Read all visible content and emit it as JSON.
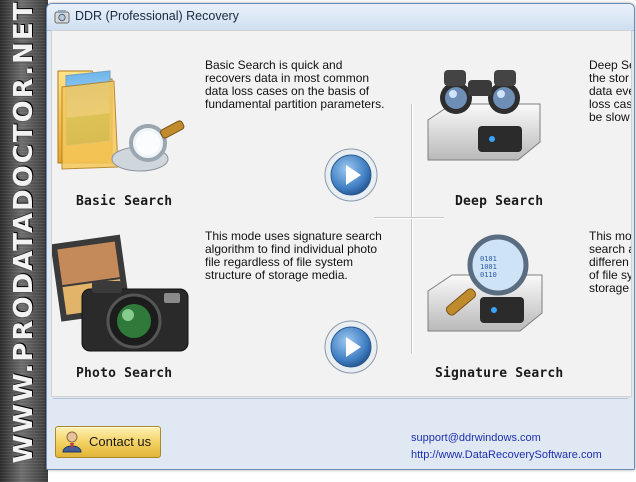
{
  "side_banner": {
    "text": "WWW.PRODATADOCTOR.NET"
  },
  "window": {
    "title": "DDR (Professional) Recovery"
  },
  "features": {
    "basic": {
      "label": "Basic Search",
      "description": "Basic Search is quick and recovers data in most common data loss cases on the basis of fundamental partition parameters."
    },
    "deep": {
      "label": "Deep Search",
      "description_visible": "Deep Se\nthe stor\ndata eve\nloss cas\nbe slow"
    },
    "photo": {
      "label": "Photo Search",
      "description": "This mode uses signature search algorithm to find individual photo file regardless of file system structure of storage media."
    },
    "signature": {
      "label": "Signature Search",
      "description_visible": "This mo\nsearch a\ndifferen\nof file sy\nstorage"
    }
  },
  "footer": {
    "contact_label": "Contact us",
    "email": "support@ddrwindows.com",
    "website": "http://www.DataRecoverySoftware.com"
  },
  "colors": {
    "window_frame": "#6b8bb5",
    "content_bg": "#f2f2f2",
    "footer_bg": "#dfe8f3",
    "play_button": "#3f7ec2",
    "link": "#1e2fae",
    "contact_button": "#f2cf5e"
  },
  "icons": {
    "app": "app-icon",
    "play": "play-icon",
    "contact": "person-icon"
  }
}
